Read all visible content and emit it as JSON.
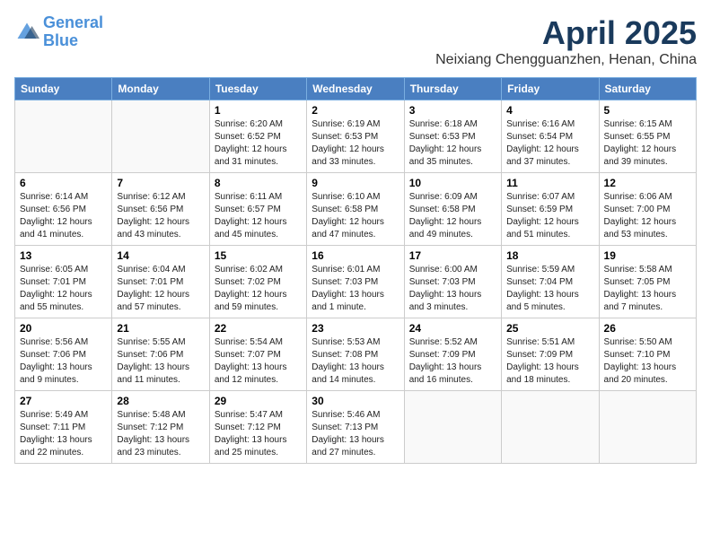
{
  "header": {
    "logo_line1": "General",
    "logo_line2": "Blue",
    "month": "April 2025",
    "location": "Neixiang Chengguanzhen, Henan, China"
  },
  "days_of_week": [
    "Sunday",
    "Monday",
    "Tuesday",
    "Wednesday",
    "Thursday",
    "Friday",
    "Saturday"
  ],
  "weeks": [
    [
      {
        "day": "",
        "info": ""
      },
      {
        "day": "",
        "info": ""
      },
      {
        "day": "1",
        "info": "Sunrise: 6:20 AM\nSunset: 6:52 PM\nDaylight: 12 hours\nand 31 minutes."
      },
      {
        "day": "2",
        "info": "Sunrise: 6:19 AM\nSunset: 6:53 PM\nDaylight: 12 hours\nand 33 minutes."
      },
      {
        "day": "3",
        "info": "Sunrise: 6:18 AM\nSunset: 6:53 PM\nDaylight: 12 hours\nand 35 minutes."
      },
      {
        "day": "4",
        "info": "Sunrise: 6:16 AM\nSunset: 6:54 PM\nDaylight: 12 hours\nand 37 minutes."
      },
      {
        "day": "5",
        "info": "Sunrise: 6:15 AM\nSunset: 6:55 PM\nDaylight: 12 hours\nand 39 minutes."
      }
    ],
    [
      {
        "day": "6",
        "info": "Sunrise: 6:14 AM\nSunset: 6:56 PM\nDaylight: 12 hours\nand 41 minutes."
      },
      {
        "day": "7",
        "info": "Sunrise: 6:12 AM\nSunset: 6:56 PM\nDaylight: 12 hours\nand 43 minutes."
      },
      {
        "day": "8",
        "info": "Sunrise: 6:11 AM\nSunset: 6:57 PM\nDaylight: 12 hours\nand 45 minutes."
      },
      {
        "day": "9",
        "info": "Sunrise: 6:10 AM\nSunset: 6:58 PM\nDaylight: 12 hours\nand 47 minutes."
      },
      {
        "day": "10",
        "info": "Sunrise: 6:09 AM\nSunset: 6:58 PM\nDaylight: 12 hours\nand 49 minutes."
      },
      {
        "day": "11",
        "info": "Sunrise: 6:07 AM\nSunset: 6:59 PM\nDaylight: 12 hours\nand 51 minutes."
      },
      {
        "day": "12",
        "info": "Sunrise: 6:06 AM\nSunset: 7:00 PM\nDaylight: 12 hours\nand 53 minutes."
      }
    ],
    [
      {
        "day": "13",
        "info": "Sunrise: 6:05 AM\nSunset: 7:01 PM\nDaylight: 12 hours\nand 55 minutes."
      },
      {
        "day": "14",
        "info": "Sunrise: 6:04 AM\nSunset: 7:01 PM\nDaylight: 12 hours\nand 57 minutes."
      },
      {
        "day": "15",
        "info": "Sunrise: 6:02 AM\nSunset: 7:02 PM\nDaylight: 12 hours\nand 59 minutes."
      },
      {
        "day": "16",
        "info": "Sunrise: 6:01 AM\nSunset: 7:03 PM\nDaylight: 13 hours\nand 1 minute."
      },
      {
        "day": "17",
        "info": "Sunrise: 6:00 AM\nSunset: 7:03 PM\nDaylight: 13 hours\nand 3 minutes."
      },
      {
        "day": "18",
        "info": "Sunrise: 5:59 AM\nSunset: 7:04 PM\nDaylight: 13 hours\nand 5 minutes."
      },
      {
        "day": "19",
        "info": "Sunrise: 5:58 AM\nSunset: 7:05 PM\nDaylight: 13 hours\nand 7 minutes."
      }
    ],
    [
      {
        "day": "20",
        "info": "Sunrise: 5:56 AM\nSunset: 7:06 PM\nDaylight: 13 hours\nand 9 minutes."
      },
      {
        "day": "21",
        "info": "Sunrise: 5:55 AM\nSunset: 7:06 PM\nDaylight: 13 hours\nand 11 minutes."
      },
      {
        "day": "22",
        "info": "Sunrise: 5:54 AM\nSunset: 7:07 PM\nDaylight: 13 hours\nand 12 minutes."
      },
      {
        "day": "23",
        "info": "Sunrise: 5:53 AM\nSunset: 7:08 PM\nDaylight: 13 hours\nand 14 minutes."
      },
      {
        "day": "24",
        "info": "Sunrise: 5:52 AM\nSunset: 7:09 PM\nDaylight: 13 hours\nand 16 minutes."
      },
      {
        "day": "25",
        "info": "Sunrise: 5:51 AM\nSunset: 7:09 PM\nDaylight: 13 hours\nand 18 minutes."
      },
      {
        "day": "26",
        "info": "Sunrise: 5:50 AM\nSunset: 7:10 PM\nDaylight: 13 hours\nand 20 minutes."
      }
    ],
    [
      {
        "day": "27",
        "info": "Sunrise: 5:49 AM\nSunset: 7:11 PM\nDaylight: 13 hours\nand 22 minutes."
      },
      {
        "day": "28",
        "info": "Sunrise: 5:48 AM\nSunset: 7:12 PM\nDaylight: 13 hours\nand 23 minutes."
      },
      {
        "day": "29",
        "info": "Sunrise: 5:47 AM\nSunset: 7:12 PM\nDaylight: 13 hours\nand 25 minutes."
      },
      {
        "day": "30",
        "info": "Sunrise: 5:46 AM\nSunset: 7:13 PM\nDaylight: 13 hours\nand 27 minutes."
      },
      {
        "day": "",
        "info": ""
      },
      {
        "day": "",
        "info": ""
      },
      {
        "day": "",
        "info": ""
      }
    ]
  ]
}
